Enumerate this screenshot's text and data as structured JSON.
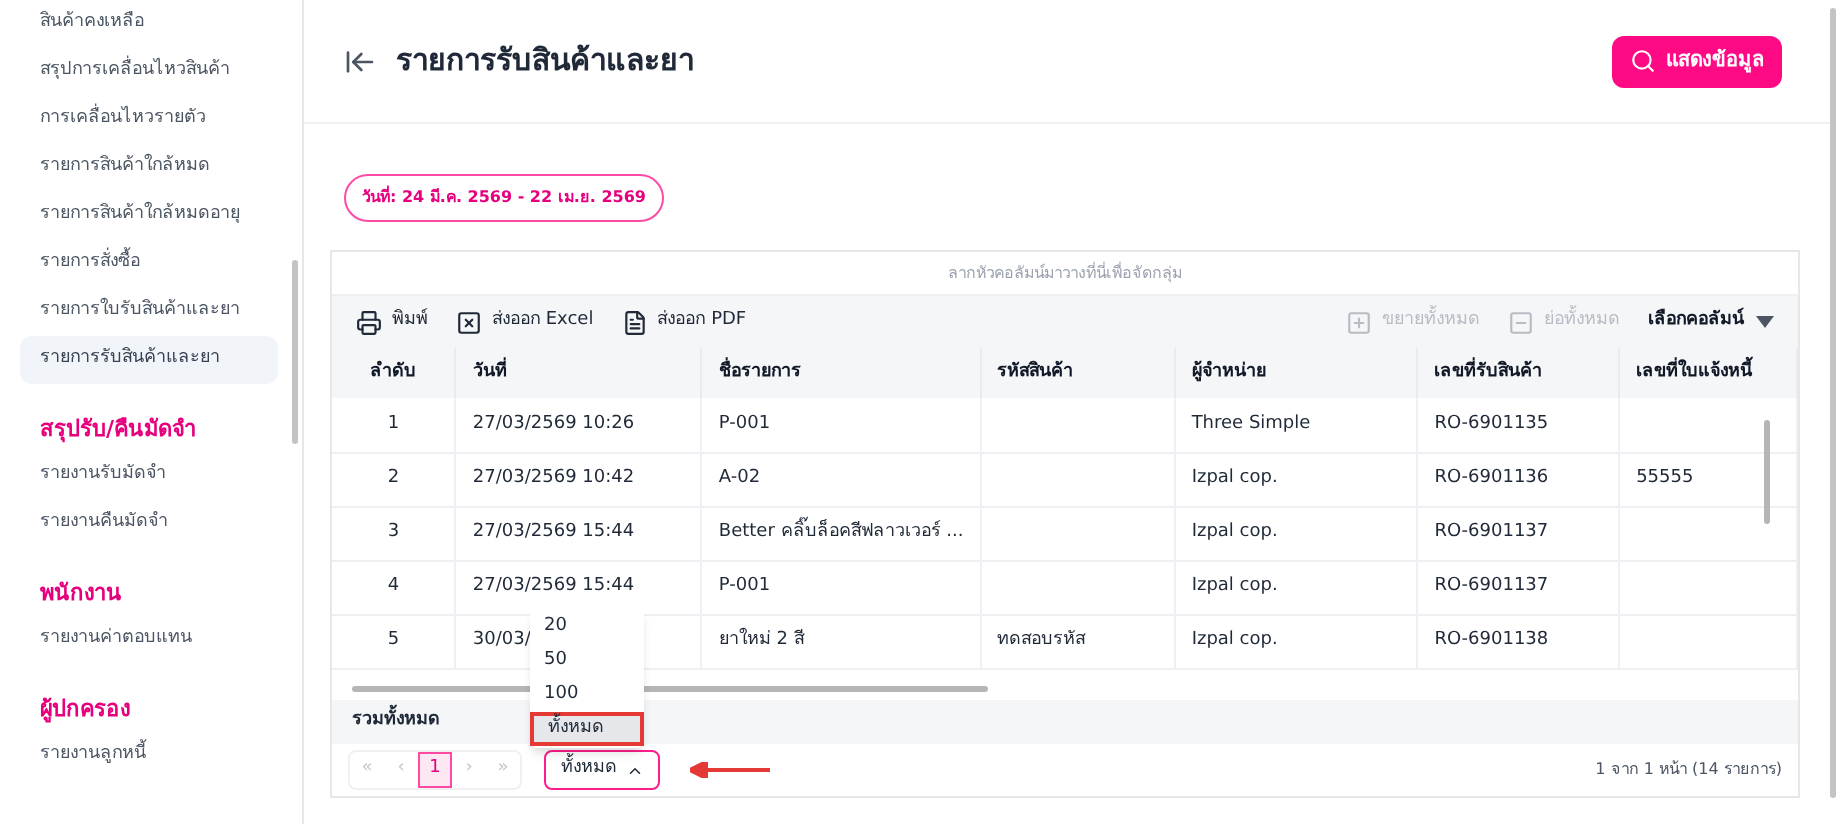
{
  "sidebar": {
    "items": [
      {
        "label": "สินค้าคงเหลือ",
        "kind": "item",
        "selected": false
      },
      {
        "label": "สรุปการเคลื่อนไหวสินค้า",
        "kind": "item",
        "selected": false
      },
      {
        "label": "การเคลื่อนไหวรายตัว",
        "kind": "item",
        "selected": false
      },
      {
        "label": "รายการสินค้าใกล้หมด",
        "kind": "item",
        "selected": false
      },
      {
        "label": "รายการสินค้าใกล้หมดอายุ",
        "kind": "item",
        "selected": false
      },
      {
        "label": "รายการสั่งซื้อ",
        "kind": "item",
        "selected": false
      },
      {
        "label": "รายการใบรับสินค้าและยา",
        "kind": "item",
        "selected": false
      },
      {
        "label": "รายการรับสินค้าและยา",
        "kind": "item",
        "selected": true
      },
      {
        "label": "สรุปรับ/คืนมัดจำ",
        "kind": "heading"
      },
      {
        "label": "รายงานรับมัดจำ",
        "kind": "item",
        "selected": false
      },
      {
        "label": "รายงานคืนมัดจำ",
        "kind": "item",
        "selected": false
      },
      {
        "label": "พนักงาน",
        "kind": "heading"
      },
      {
        "label": "รายงานค่าตอบแทน",
        "kind": "item",
        "selected": false
      },
      {
        "label": "ผู้ปกครอง",
        "kind": "heading"
      },
      {
        "label": "รายงานลูกหนี้",
        "kind": "item",
        "selected": false
      }
    ]
  },
  "header": {
    "title": "รายการรับสินค้าและยา",
    "show_button": "แสดงข้อมูล"
  },
  "date_chip": "วันที่: 24 มี.ค. 2569 - 22 เม.ย. 2569",
  "table": {
    "group_hint": "ลากหัวคอลัมน์มาวางที่นี่เพื่อจัดกลุ่ม",
    "toolbar": [
      {
        "label": "พิมพ์",
        "kind": "print",
        "disabled": false
      },
      {
        "label": "ส่งออก Excel",
        "kind": "excel",
        "disabled": false
      },
      {
        "label": "ส่งออก PDF",
        "kind": "pdf",
        "disabled": false
      },
      {
        "label": "ขยายทั้งหมด",
        "kind": "expand",
        "disabled": true
      },
      {
        "label": "ย่อทั้งหมด",
        "kind": "collapse",
        "disabled": true
      }
    ],
    "columns_button": "เลือกคอลัมน์",
    "columns": [
      "ลำดับ",
      "วันที่",
      "ชื่อรายการ",
      "รหัสสินค้า",
      "ผู้จำหน่าย",
      "เลขที่รับสินค้า",
      "เลขที่ใบแจ้งหนี้"
    ],
    "rows": [
      [
        "1",
        "27/03/2569 10:26",
        "P-001",
        "",
        "Three Simple",
        "RO-6901135",
        ""
      ],
      [
        "2",
        "27/03/2569 10:42",
        "A-02",
        "",
        "Izpal cop.",
        "RO-6901136",
        "55555"
      ],
      [
        "3",
        "27/03/2569 15:44",
        "Better คลิ๊บล็อคสีฟลาวเวอร์ ...",
        "",
        "Izpal cop.",
        "RO-6901137",
        ""
      ],
      [
        "4",
        "27/03/2569 15:44",
        "P-001",
        "",
        "Izpal cop.",
        "RO-6901137",
        ""
      ],
      [
        "5",
        "30/03/",
        "ยาใหม่ 2 สี",
        "ทดสอบรหัส",
        "Izpal cop.",
        "RO-6901138",
        ""
      ]
    ],
    "footer_label": "รวมทั้งหมด"
  },
  "pagination": {
    "buttons": [
      {
        "label": "«",
        "selected": false
      },
      {
        "label": "‹",
        "selected": false
      },
      {
        "label": "1",
        "selected": true
      },
      {
        "label": "›",
        "selected": false
      },
      {
        "label": "»",
        "selected": false
      }
    ],
    "page_size": "ทั้งหมด",
    "summary": "1 จาก 1 หน้า (14 รายการ)"
  },
  "page_size_menu": {
    "options": [
      {
        "label": "20",
        "selected": false
      },
      {
        "label": "50",
        "selected": false
      },
      {
        "label": "100",
        "selected": false
      },
      {
        "label": "ทั้งหมด",
        "selected": true
      }
    ]
  }
}
